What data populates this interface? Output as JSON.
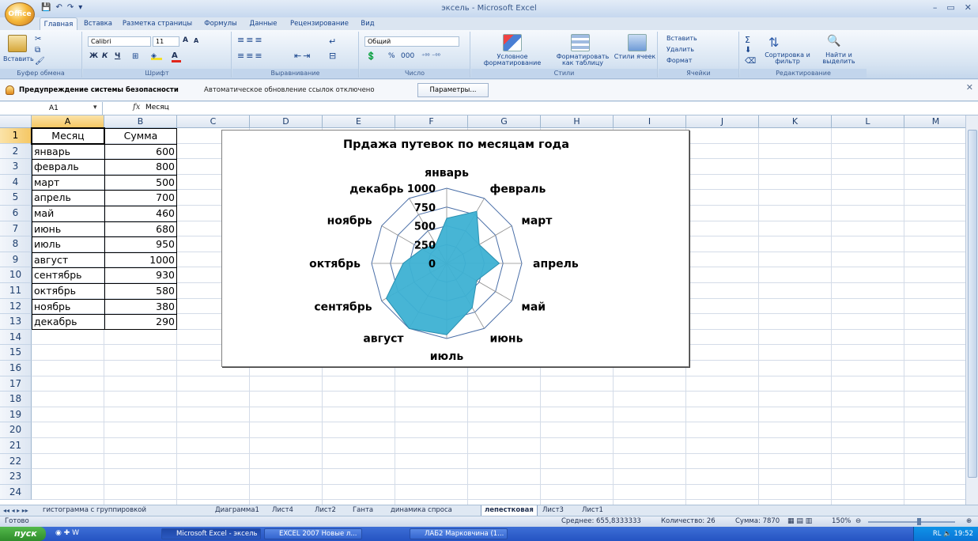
{
  "window": {
    "title": "эксель - Microsoft Excel",
    "controls": [
      "–",
      "▭",
      "✕"
    ]
  },
  "office_button": {
    "label": "Office"
  },
  "qat": [
    "💾",
    "↶",
    "↷",
    "▾"
  ],
  "tabs": [
    "Главная",
    "Вставка",
    "Разметка страницы",
    "Формулы",
    "Данные",
    "Рецензирование",
    "Вид"
  ],
  "active_tab": 0,
  "ribbon": {
    "clipboard": {
      "paste": "Вставить",
      "label": "Буфер обмена"
    },
    "font": {
      "name": "Calibri",
      "size": "11",
      "bold": "Ж",
      "italic": "К",
      "underline": "Ч",
      "grow": "A",
      "shrink": "A",
      "label": "Шрифт"
    },
    "alignment": {
      "label": "Выравнивание"
    },
    "number": {
      "format": "Общий",
      "percent": "%",
      "thousands": "000",
      "label": "Число"
    },
    "styles": {
      "conditional": "Условное форматирование",
      "as_table": "Форматировать как таблицу",
      "cell_styles": "Стили ячеек",
      "label": "Стили"
    },
    "cells": {
      "insert": "Вставить",
      "delete": "Удалить",
      "format": "Формат",
      "label": "Ячейки"
    },
    "editing": {
      "sort": "Сортировка и фильтр",
      "find": "Найти и выделить",
      "sum": "Σ",
      "label": "Редактирование"
    }
  },
  "security": {
    "bold": "Предупреждение системы безопасности",
    "message": "Автоматическое обновление ссылок отключено",
    "button": "Параметры..."
  },
  "formula": {
    "name_box": "A1",
    "fx": "fx",
    "value": "Месяц"
  },
  "columns": [
    "A",
    "B",
    "C",
    "D",
    "E",
    "F",
    "G",
    "H",
    "I",
    "J",
    "K",
    "L",
    "M"
  ],
  "rows": [
    "1",
    "2",
    "3",
    "4",
    "5",
    "6",
    "7",
    "8",
    "9",
    "10",
    "11",
    "12",
    "13",
    "14",
    "15",
    "16",
    "17",
    "18",
    "19",
    "20",
    "21",
    "22",
    "23",
    "24"
  ],
  "table": {
    "header": [
      "Месяц",
      "Сумма"
    ],
    "data": [
      [
        "январь",
        "600"
      ],
      [
        "февраль",
        "800"
      ],
      [
        "март",
        "500"
      ],
      [
        "апрель",
        "700"
      ],
      [
        "май",
        "460"
      ],
      [
        "июнь",
        "680"
      ],
      [
        "июль",
        "950"
      ],
      [
        "август",
        "1000"
      ],
      [
        "сентябрь",
        "930"
      ],
      [
        "октябрь",
        "580"
      ],
      [
        "ноябрь",
        "380"
      ],
      [
        "декабрь",
        "290"
      ]
    ]
  },
  "chart_data": {
    "type": "radar",
    "title": "Прдажа путевок по месяцам года",
    "categories": [
      "январь",
      "февраль",
      "март",
      "апрель",
      "май",
      "июнь",
      "июль",
      "август",
      "сентябрь",
      "октябрь",
      "ноябрь",
      "декабрь"
    ],
    "series": [
      {
        "values": [
          600,
          800,
          500,
          700,
          460,
          680,
          950,
          1000,
          930,
          580,
          380,
          290
        ]
      }
    ],
    "rlim": [
      0,
      1000
    ],
    "ticks": [
      "0",
      "250",
      "500",
      "750",
      "1000"
    ],
    "fill": "#3db1d3",
    "legend": "none"
  },
  "sheets": [
    "гистограмма с группировкой",
    "Диаграмма1",
    "Лист4",
    "Лист2",
    "Ганта",
    "динамика спроса",
    "лепестковая",
    "Лист3",
    "Лист1"
  ],
  "active_sheet": 6,
  "status": {
    "ready": "Готово",
    "avg": "Среднее: 655,8333333",
    "count": "Количество: 26",
    "sum": "Сумма: 7870",
    "zoom": "150%"
  },
  "taskbar": {
    "start": "пуск",
    "items": [
      "Microsoft Excel - эксель",
      "EXCEL 2007 Новые л...",
      "ЛАБ2 Марковчина (1..."
    ],
    "tray_lang": "RL",
    "clock": "19:52"
  }
}
